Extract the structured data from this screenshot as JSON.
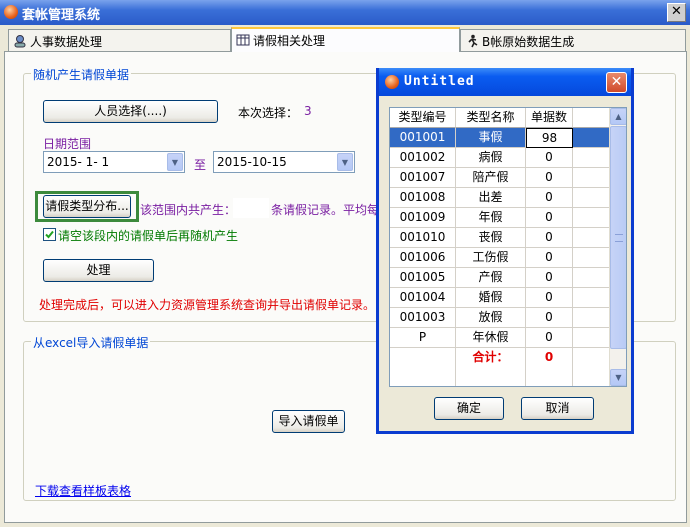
{
  "window": {
    "title": "套帐管理系统",
    "close_glyph": "✕"
  },
  "tabs": [
    {
      "label": "人事数据处理",
      "icon": "personnel-icon"
    },
    {
      "label": "请假相关处理",
      "icon": "table-icon"
    },
    {
      "label": "B帐原始数据生成",
      "icon": "runner-icon"
    }
  ],
  "random_group": {
    "title": "随机产生请假单据",
    "select_button": "人员选择(....)",
    "current_select_label": "本次选择：",
    "current_select_count": "3",
    "date_range_label": "日期范围",
    "date_from": "2015- 1- 1",
    "date_to_label": "至",
    "date_to": "2015-10-15",
    "leave_dist_button": "请假类型分布...",
    "range_text_1": "该范围内共产生：",
    "range_text_2": "条请假记录。平均每",
    "clear_checkbox_label": "请空该段内的请假单后再随机产生",
    "clear_checked": true,
    "process_button": "处理",
    "process_note": "处理完成后，可以进入力资源管理系统查询并导出请假单记录。"
  },
  "excel_group": {
    "title": "从excel导入请假单据",
    "import_button": "导入请假单",
    "download_link": "下载查看样板表格"
  },
  "dialog": {
    "title": "Untitled",
    "columns": [
      "类型编号",
      "类型名称",
      "单据数"
    ],
    "rows": [
      {
        "code": "001001",
        "name": "事假",
        "count": "98"
      },
      {
        "code": "001002",
        "name": "病假",
        "count": "0"
      },
      {
        "code": "001007",
        "name": "陪产假",
        "count": "0"
      },
      {
        "code": "001008",
        "name": "出差",
        "count": "0"
      },
      {
        "code": "001009",
        "name": "年假",
        "count": "0"
      },
      {
        "code": "001010",
        "name": "丧假",
        "count": "0"
      },
      {
        "code": "001006",
        "name": "工伤假",
        "count": "0"
      },
      {
        "code": "001005",
        "name": "产假",
        "count": "0"
      },
      {
        "code": "001004",
        "name": "婚假",
        "count": "0"
      },
      {
        "code": "001003",
        "name": "放假",
        "count": "0"
      },
      {
        "code": "P",
        "name": "年休假",
        "count": "0"
      }
    ],
    "total_label": "合计：",
    "total_value": "0",
    "ok_button": "确定",
    "cancel_button": "取消",
    "close_glyph": "✕"
  }
}
